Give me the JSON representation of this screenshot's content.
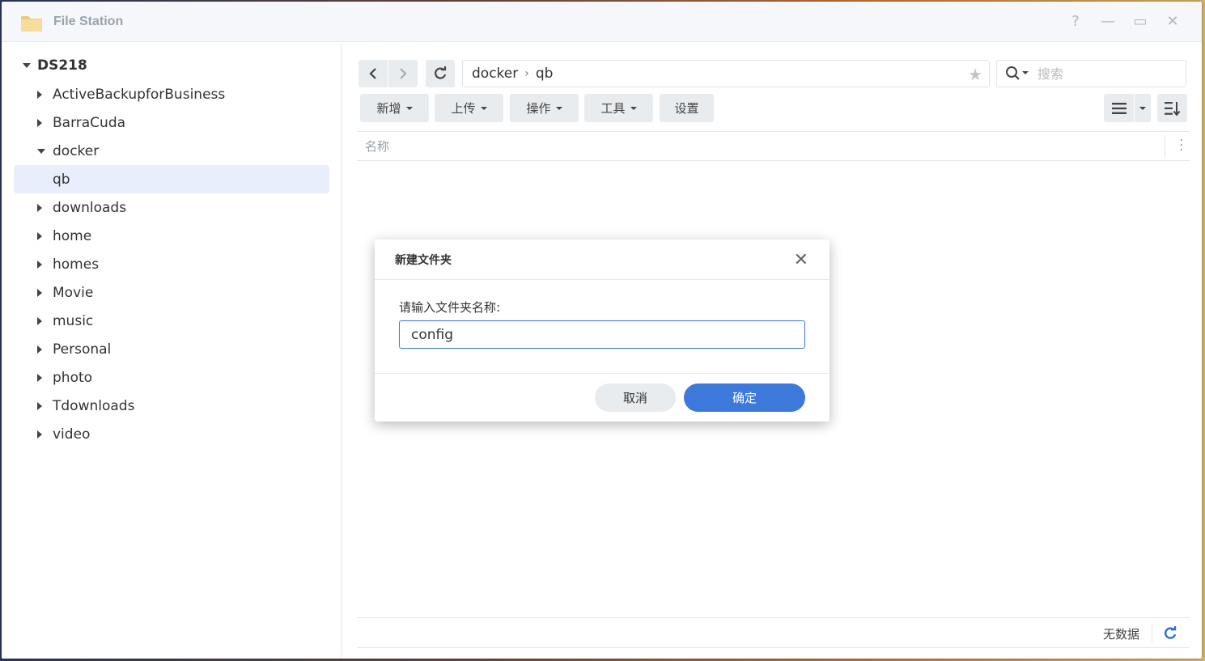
{
  "window": {
    "title": "File Station",
    "controls": {
      "help": "?",
      "minimize": "—",
      "maximize": "▭",
      "close": "✕"
    }
  },
  "sidebar": {
    "root": "DS218",
    "items": [
      {
        "label": "ActiveBackupforBusiness",
        "expanded": false
      },
      {
        "label": "BarraCuda",
        "expanded": false
      },
      {
        "label": "docker",
        "expanded": true
      },
      {
        "label": "qb",
        "selected": true
      },
      {
        "label": "downloads",
        "expanded": false
      },
      {
        "label": "home",
        "expanded": false
      },
      {
        "label": "homes",
        "expanded": false
      },
      {
        "label": "Movie",
        "expanded": false
      },
      {
        "label": "music",
        "expanded": false
      },
      {
        "label": "Personal",
        "expanded": false
      },
      {
        "label": "photo",
        "expanded": false
      },
      {
        "label": "Tdownloads",
        "expanded": false
      },
      {
        "label": "video",
        "expanded": false
      }
    ]
  },
  "path": {
    "segments": [
      "docker",
      "qb"
    ]
  },
  "search": {
    "placeholder": "搜索"
  },
  "toolbar": {
    "create_label": "新增",
    "upload_label": "上传",
    "action_label": "操作",
    "tools_label": "工具",
    "settings_label": "设置"
  },
  "list": {
    "name_header": "名称"
  },
  "footer": {
    "status": "无数据"
  },
  "dialog": {
    "title": "新建文件夹",
    "prompt": "请输入文件夹名称:",
    "input_value": "config",
    "cancel_label": "取消",
    "ok_label": "确定"
  },
  "colors": {
    "accent": "#3d78db",
    "selected_bg": "#e8eefb"
  }
}
